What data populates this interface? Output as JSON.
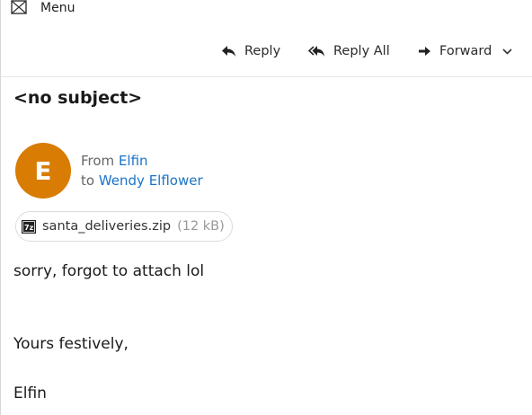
{
  "menu": {
    "label": "Menu",
    "icon": "envelope-icon"
  },
  "toolbar": {
    "reply_label": "Reply",
    "reply_all_label": "Reply All",
    "forward_label": "Forward"
  },
  "message": {
    "subject": "<no subject>",
    "avatar_letter": "E",
    "avatar_color": "#d97c04",
    "from_prefix": "From",
    "from_name": "Elfin",
    "to_prefix": "to",
    "to_name": "Wendy Elflower",
    "link_color": "#1a73c8",
    "attachment": {
      "name": "santa_deliveries.zip",
      "size": "(12 kB)",
      "icon": "7z-archive-icon"
    },
    "body_lines": [
      "sorry, forgot to attach lol",
      "Yours festively,",
      "Elfin"
    ]
  }
}
